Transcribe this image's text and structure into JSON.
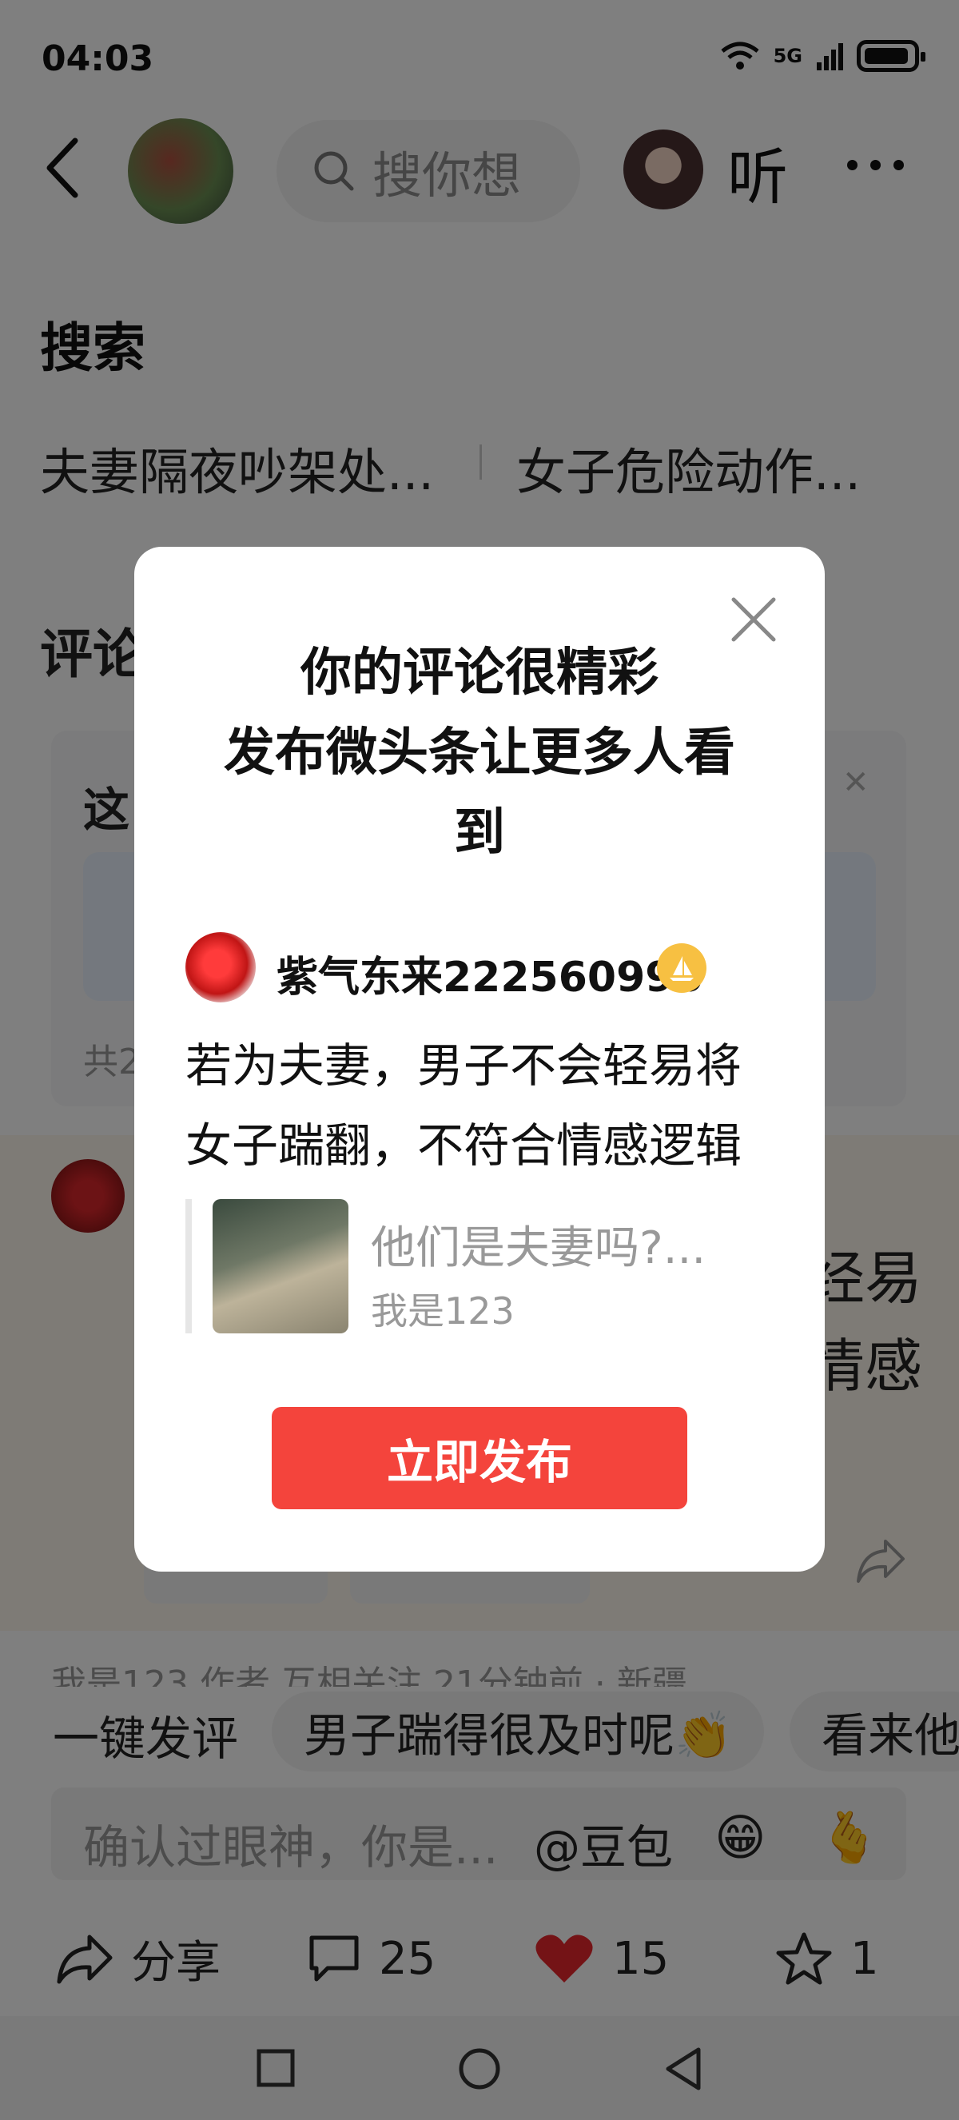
{
  "status_bar": {
    "time": "04:03",
    "network": "5G"
  },
  "header": {
    "search_placeholder": "搜你想",
    "listen_label": "听"
  },
  "search_section": {
    "title": "搜索",
    "suggestions": [
      "夫妻隔夜吵架处...",
      "女子危险动作..."
    ]
  },
  "comment_section": {
    "title_partial": "评论",
    "card_title_partial": "这",
    "card_count_partial": "共2"
  },
  "background_comment": {
    "text_fragment_1": "经易",
    "text_fragment_2": "情感",
    "next_author_partial": "我是123  作者  互相关注  21分钟前 · 新疆"
  },
  "quick_comment": {
    "label": "一键发评",
    "chips": [
      "男子踹得很及时呢👏",
      "看来他"
    ]
  },
  "input_bar": {
    "placeholder": "确认过眼神，你是...",
    "mention": "@豆包",
    "emoji1": "😁",
    "emoji2": "🫰"
  },
  "actions": {
    "share_label": "分享",
    "comment_count": "25",
    "like_count": "15",
    "favorite_count": "1"
  },
  "modal": {
    "title_line1": "你的评论很精彩",
    "title_line2": "发布微头条让更多人看",
    "title_line3": "到",
    "username": "紫气东来222560996",
    "comment_line1": "若为夫妻，男子不会轻易将",
    "comment_line2": "女子踹翻，不符合情感逻辑",
    "quoted_title": "他们是夫妻吗?...",
    "quoted_author": "我是123",
    "publish_button": "立即发布"
  },
  "colors": {
    "accent_red": "#f4443c",
    "badge_gold": "#f7c042"
  }
}
